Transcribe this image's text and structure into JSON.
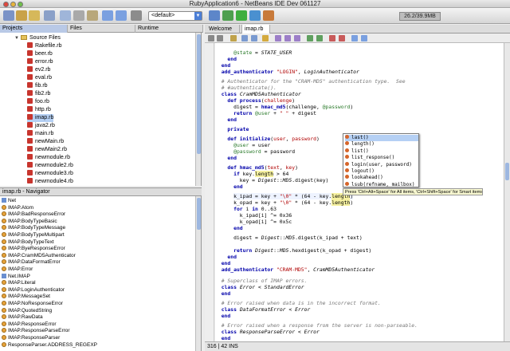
{
  "window": {
    "title": "RubyApplication6 - NetBeans IDE Dev 061127"
  },
  "toolbar": {
    "config_combo": "<default>",
    "memory": "26.2/39.9MB"
  },
  "left_tabs": [
    "Projects",
    "Files",
    "Runtime"
  ],
  "tree": {
    "folder": "Source Files",
    "files": [
      "Rakefile.rb",
      "beer.rb",
      "error.rb",
      "ev2.rb",
      "eval.rb",
      "fib.rb",
      "fib2.rb",
      "foo.rb",
      "http.rb",
      "imap.rb",
      "java2.rb",
      "main.rb",
      "newMain.rb",
      "newMain2.rb",
      "newmodule.rb",
      "newmodule2.rb",
      "newmodule3.rb",
      "newmodule4.rb",
      "optparse.rb"
    ]
  },
  "navigator": {
    "title": "imap.rb - Navigator",
    "items": [
      "Net",
      "IMAP.Atom",
      "IMAP.BadResponseError",
      "IMAP.BodyTypeBasic",
      "IMAP.BodyTypeMessage",
      "IMAP.BodyTypeMultipart",
      "IMAP.BodyTypeText",
      "IMAP.ByeResponseError",
      "IMAP.CramMD5Authenticator",
      "IMAP.DataFormatError",
      "IMAP.Error",
      "Net.IMAP",
      "IMAP.Literal",
      "IMAP.LoginAuthenticator",
      "IMAP.MessageSet",
      "IMAP.NoResponseError",
      "IMAP.QuotedString",
      "IMAP.RawData",
      "IMAP.ResponseError",
      "IMAP.ResponseParseError",
      "IMAP.ResponseParser",
      "ResponseParser.ADDRESS_REGEXP"
    ]
  },
  "editor": {
    "tabs": [
      "Welcome",
      "imap.rb"
    ],
    "status": "316 | 42  INS"
  },
  "completion": {
    "items": [
      "last()",
      "length()",
      "list()",
      "list_response()",
      "login(user, password)",
      "logout()",
      "lookahead()",
      "lsub(refname, mailbox)"
    ],
    "hint": "Press 'Ctrl+Alt+Space' for All items, 'Ctrl+Shift+Space' for Smart items"
  }
}
